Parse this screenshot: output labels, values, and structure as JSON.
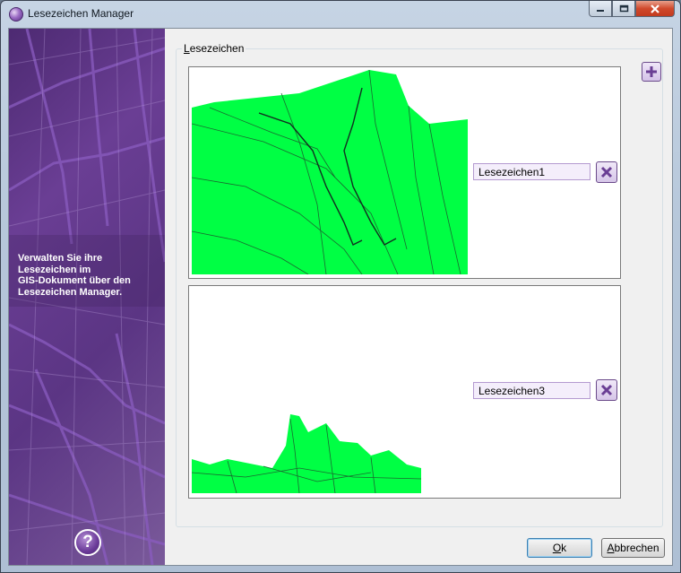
{
  "window": {
    "title": "Lesezeichen Manager"
  },
  "sidebar": {
    "description": "Verwalten Sie ihre\nLesezeichen im\nGIS-Dokument über den\nLesezeichen Manager.",
    "help_label": "?"
  },
  "group": {
    "legend_first_letter": "L",
    "legend_rest": "esezeichen"
  },
  "bookmarks": [
    {
      "name": "Lesezeichen1"
    },
    {
      "name": "Lesezeichen3"
    }
  ],
  "buttons": {
    "ok_first_letter": "O",
    "ok_rest": "k",
    "cancel_first_letter": "A",
    "cancel_rest": "bbrechen"
  },
  "colors": {
    "map_fill": "#00ff44",
    "accent": "#6a3e94"
  },
  "icons": [
    "app-icon",
    "minimize-icon",
    "maximize-icon",
    "close-icon",
    "plus-icon",
    "delete-x-icon",
    "help-icon"
  ]
}
